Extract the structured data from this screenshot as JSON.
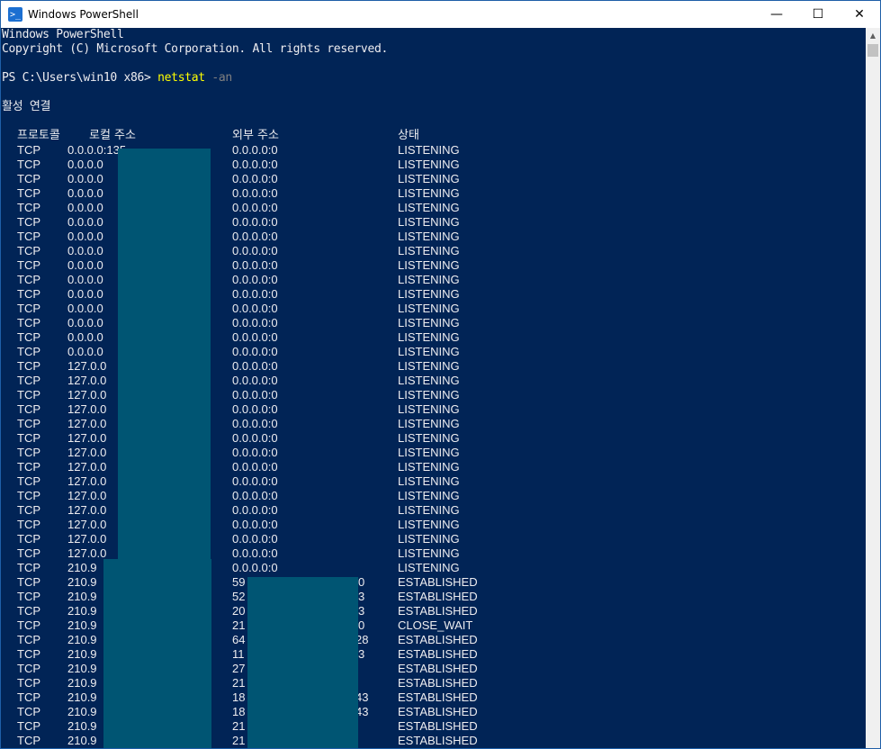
{
  "window": {
    "title": "Windows PowerShell",
    "icon": "powershell-icon",
    "controls": {
      "minimize": "—",
      "maximize": "☐",
      "close": "✕"
    }
  },
  "console": {
    "banner_line1": "Windows PowerShell",
    "banner_line2": "Copyright (C) Microsoft Corporation. All rights reserved.",
    "prompt": "PS C:\\Users\\win10 x86> ",
    "command": "netstat",
    "argument": " -an",
    "section_title": "활성 연결",
    "headers": {
      "proto": "프로토콜",
      "local": "로컬 주소",
      "foreign": "외부 주소",
      "state": "상태"
    },
    "rows": [
      {
        "proto": "TCP",
        "local": "0.0.0.0:135",
        "foreign": "0.0.0.0:0",
        "state": "LISTENING"
      },
      {
        "proto": "TCP",
        "local": "0.0.0.0",
        "foreign": "0.0.0.0:0",
        "state": "LISTENING"
      },
      {
        "proto": "TCP",
        "local": "0.0.0.0",
        "foreign": "0.0.0.0:0",
        "state": "LISTENING"
      },
      {
        "proto": "TCP",
        "local": "0.0.0.0",
        "foreign": "0.0.0.0:0",
        "state": "LISTENING"
      },
      {
        "proto": "TCP",
        "local": "0.0.0.0",
        "foreign": "0.0.0.0:0",
        "state": "LISTENING"
      },
      {
        "proto": "TCP",
        "local": "0.0.0.0",
        "foreign": "0.0.0.0:0",
        "state": "LISTENING"
      },
      {
        "proto": "TCP",
        "local": "0.0.0.0",
        "foreign": "0.0.0.0:0",
        "state": "LISTENING"
      },
      {
        "proto": "TCP",
        "local": "0.0.0.0",
        "foreign": "0.0.0.0:0",
        "state": "LISTENING"
      },
      {
        "proto": "TCP",
        "local": "0.0.0.0",
        "foreign": "0.0.0.0:0",
        "state": "LISTENING"
      },
      {
        "proto": "TCP",
        "local": "0.0.0.0",
        "foreign": "0.0.0.0:0",
        "state": "LISTENING"
      },
      {
        "proto": "TCP",
        "local": "0.0.0.0",
        "foreign": "0.0.0.0:0",
        "state": "LISTENING"
      },
      {
        "proto": "TCP",
        "local": "0.0.0.0",
        "foreign": "0.0.0.0:0",
        "state": "LISTENING"
      },
      {
        "proto": "TCP",
        "local": "0.0.0.0",
        "foreign": "0.0.0.0:0",
        "state": "LISTENING"
      },
      {
        "proto": "TCP",
        "local": "0.0.0.0",
        "foreign": "0.0.0.0:0",
        "state": "LISTENING"
      },
      {
        "proto": "TCP",
        "local": "0.0.0.0",
        "foreign": "0.0.0.0:0",
        "state": "LISTENING"
      },
      {
        "proto": "TCP",
        "local": "127.0.0",
        "foreign": "0.0.0.0:0",
        "state": "LISTENING"
      },
      {
        "proto": "TCP",
        "local": "127.0.0",
        "foreign": "0.0.0.0:0",
        "state": "LISTENING"
      },
      {
        "proto": "TCP",
        "local": "127.0.0",
        "foreign": "0.0.0.0:0",
        "state": "LISTENING"
      },
      {
        "proto": "TCP",
        "local": "127.0.0",
        "foreign": "0.0.0.0:0",
        "state": "LISTENING"
      },
      {
        "proto": "TCP",
        "local": "127.0.0",
        "foreign": "0.0.0.0:0",
        "state": "LISTENING"
      },
      {
        "proto": "TCP",
        "local": "127.0.0",
        "foreign": "0.0.0.0:0",
        "state": "LISTENING"
      },
      {
        "proto": "TCP",
        "local": "127.0.0",
        "foreign": "0.0.0.0:0",
        "state": "LISTENING"
      },
      {
        "proto": "TCP",
        "local": "127.0.0",
        "foreign": "0.0.0.0:0",
        "state": "LISTENING"
      },
      {
        "proto": "TCP",
        "local": "127.0.0",
        "foreign": "0.0.0.0:0",
        "state": "LISTENING"
      },
      {
        "proto": "TCP",
        "local": "127.0.0",
        "foreign": "0.0.0.0:0",
        "state": "LISTENING"
      },
      {
        "proto": "TCP",
        "local": "127.0.0",
        "foreign": "0.0.0.0:0",
        "state": "LISTENING"
      },
      {
        "proto": "TCP",
        "local": "127.0.0",
        "foreign": "0.0.0.0:0",
        "state": "LISTENING"
      },
      {
        "proto": "TCP",
        "local": "127.0.0",
        "foreign": "0.0.0.0:0",
        "state": "LISTENING"
      },
      {
        "proto": "TCP",
        "local": "127.0.0",
        "foreign": "0.0.0.0:0",
        "state": "LISTENING"
      },
      {
        "proto": "TCP",
        "local": "210.9",
        "foreign": "0.0.0.0:0",
        "state": "LISTENING"
      },
      {
        "proto": "TCP",
        "local": "210.9",
        "foreign": "59",
        "foreign_tail": "0",
        "state": "ESTABLISHED"
      },
      {
        "proto": "TCP",
        "local": "210.9",
        "foreign": "52",
        "foreign_tail": "3",
        "state": "ESTABLISHED"
      },
      {
        "proto": "TCP",
        "local": "210.9",
        "foreign": "20",
        "foreign_tail": "3",
        "state": "ESTABLISHED"
      },
      {
        "proto": "TCP",
        "local": "210.9",
        "foreign": "21",
        "foreign_tail": "0",
        "state": "CLOSE_WAIT"
      },
      {
        "proto": "TCP",
        "local": "210.9",
        "foreign": "64",
        "foreign_tail": "28",
        "state": "ESTABLISHED"
      },
      {
        "proto": "TCP",
        "local": "210.9",
        "foreign": "11",
        "foreign_tail": "3",
        "state": "ESTABLISHED"
      },
      {
        "proto": "TCP",
        "local": "210.9",
        "foreign": "27",
        "foreign_tail": "",
        "state": "ESTABLISHED"
      },
      {
        "proto": "TCP",
        "local": "210.9",
        "foreign": "21",
        "foreign_tail": "",
        "state": "ESTABLISHED"
      },
      {
        "proto": "TCP",
        "local": "210.9",
        "foreign": "18",
        "foreign_tail": "43",
        "state": "ESTABLISHED"
      },
      {
        "proto": "TCP",
        "local": "210.9",
        "foreign": "18",
        "foreign_tail": "43",
        "state": "ESTABLISHED"
      },
      {
        "proto": "TCP",
        "local": "210.9",
        "foreign": "21",
        "foreign_tail": "",
        "state": "ESTABLISHED"
      },
      {
        "proto": "TCP",
        "local": "210.9",
        "foreign": "21",
        "foreign_tail": "",
        "state": "ESTABLISHED"
      }
    ]
  },
  "colors": {
    "console_bg": "#012456",
    "console_text": "#eeedf0",
    "command": "#ffff00",
    "argument": "#808080",
    "redaction": "#005573"
  }
}
